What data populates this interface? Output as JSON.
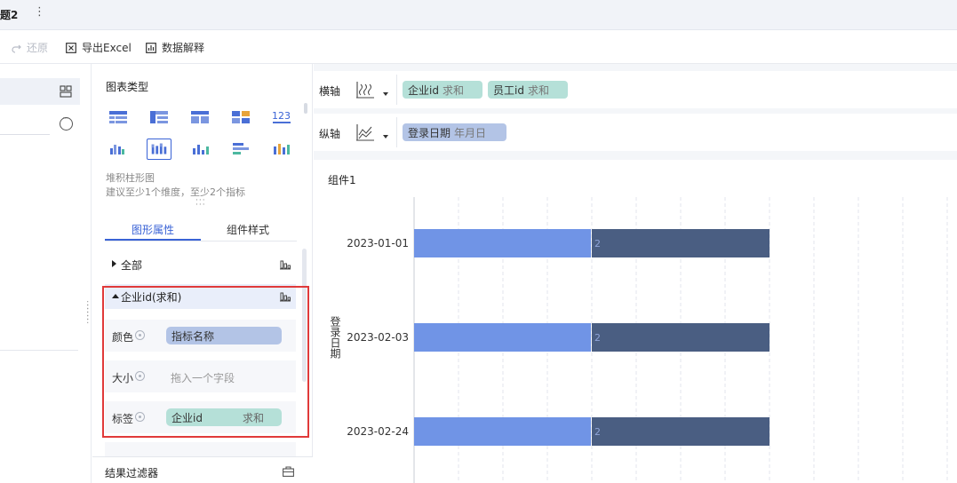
{
  "tab": {
    "title": "题2",
    "menu": "⋮"
  },
  "toolbar": {
    "redo": "还原",
    "export_excel": "导出Excel",
    "data_explain": "数据解释"
  },
  "config": {
    "chart_types_title": "图表类型",
    "chart_name": "堆积柱形图",
    "chart_hint": "建议至少1个维度，至少2个指标",
    "tabs": {
      "properties": "图形属性",
      "style": "组件样式"
    },
    "groups": {
      "all": "全部",
      "field": "企业id(求和)"
    },
    "rows": {
      "color_label": "颜色",
      "color_value": "指标名称",
      "size_label": "大小",
      "size_placeholder": "拖入一个字段",
      "tag_label": "标签",
      "tag_value": "企业id",
      "tag_agg": "求和"
    },
    "filter_label": "结果过滤器"
  },
  "axes": {
    "x_label": "横轴",
    "x_fields": [
      {
        "name": "企业id",
        "agg": "求和"
      },
      {
        "name": "员工id",
        "agg": "求和"
      }
    ],
    "y_label": "纵轴",
    "y_fields": [
      {
        "name": "登录日期",
        "agg": "年月日"
      }
    ]
  },
  "component": {
    "title": "组件1"
  },
  "colors": {
    "series1": "#7094e6",
    "series2": "#4a5e82",
    "accent": "#3a63d6",
    "highlight": "#e03a3a"
  },
  "chart_data": {
    "type": "bar",
    "orientation": "horizontal",
    "stacked": true,
    "categories": [
      "2023-01-01",
      "2023-02-03",
      "2023-02-24"
    ],
    "series": [
      {
        "values": [
          2,
          2,
          2
        ]
      },
      {
        "values": [
          2,
          2,
          2
        ],
        "labels": [
          "2",
          "2",
          "2"
        ]
      }
    ],
    "ylabel": "登录日期",
    "grid": true
  }
}
